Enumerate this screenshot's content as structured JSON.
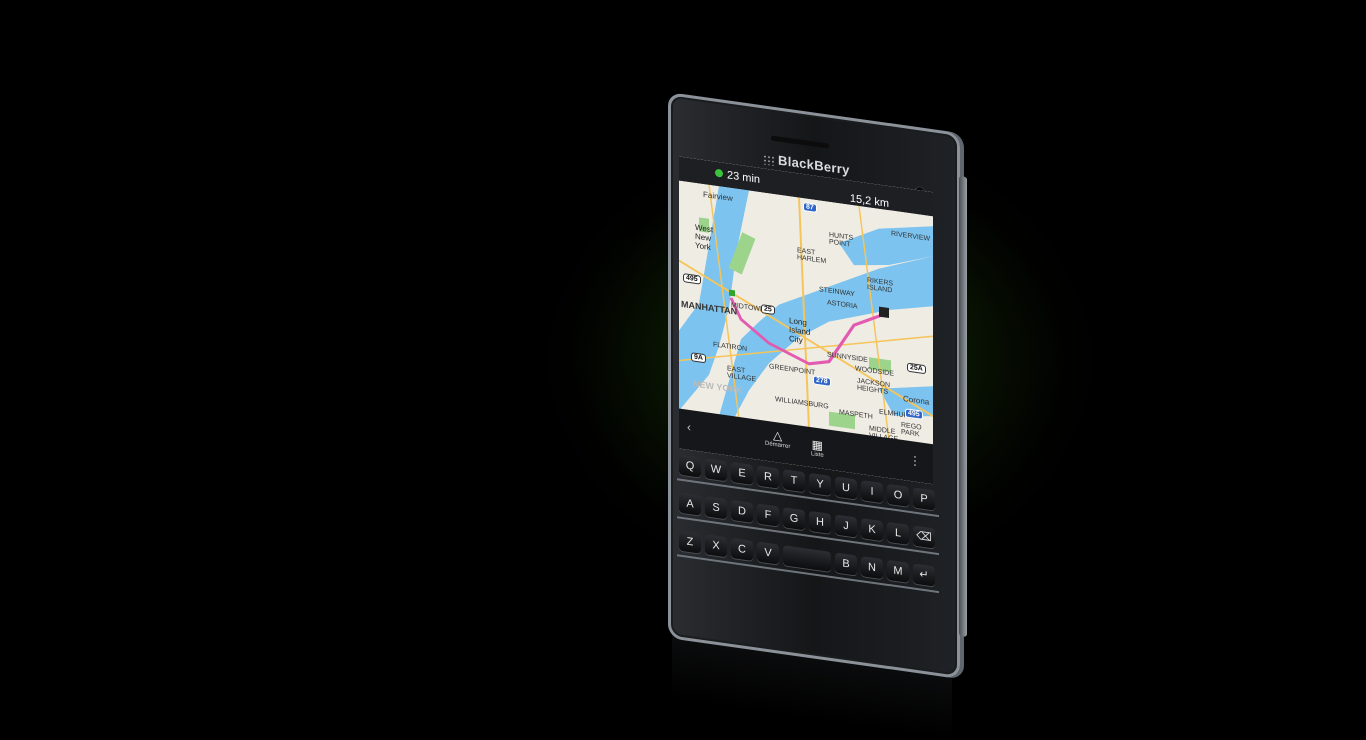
{
  "device": {
    "brand": "BlackBerry",
    "colors": {
      "glow": "#5aa014",
      "frame": "#8c9299",
      "body": "#141618"
    }
  },
  "nav": {
    "eta": "23 min",
    "distance": "15,2 km",
    "route_color": "#e25bb0",
    "actions": [
      {
        "label": "Démarrer",
        "icon": "triangle-icon"
      },
      {
        "label": "Liste",
        "icon": "grid-icon"
      }
    ]
  },
  "map": {
    "labels": {
      "fairview": "Fairview",
      "west_new_york": "West\nNew\nYork",
      "manhattan": "MANHATTAN",
      "long_island_city": "Long\nIsland\nCity",
      "midtown": "MIDTOWN",
      "astoria": "ASTORIA",
      "sunnyside": "SUNNYSIDE",
      "woodside": "WOODSIDE",
      "greenpoint": "GREENPOINT",
      "williamsburg": "WILLIAMSBURG",
      "east_village": "EAST\nVILLAGE",
      "flatiron": "FLATIRON",
      "corona": "Corona",
      "elmhurst": "ELMHURST",
      "maspeth": "MASPETH",
      "jackson_heights": "JACKSON\nHEIGHTS",
      "new_york": "NEW YORK",
      "riverview": "RIVERVIEW",
      "hunts_point": "HUNTS\nPOINT",
      "east_harlem": "EAST\nHARLEM",
      "rikers_island": "RIKERS\nISLAND",
      "steinway": "STEINWAY",
      "rego_park": "REGO\nPARK",
      "middle_village": "MIDDLE\nVILLAGE"
    },
    "shields": [
      "495",
      "25",
      "9A",
      "87",
      "278",
      "25A",
      "495"
    ]
  },
  "keyboard": {
    "row1": [
      "Q",
      "W",
      "E",
      "R",
      "T",
      "Y",
      "U",
      "I",
      "O",
      "P"
    ],
    "row2": [
      "A",
      "S",
      "D",
      "F",
      "G",
      "H",
      "J",
      "K",
      "L",
      "⌫"
    ],
    "row3": [
      "Z",
      "X",
      "C",
      "V",
      "",
      "B",
      "N",
      "M",
      "↵"
    ]
  }
}
